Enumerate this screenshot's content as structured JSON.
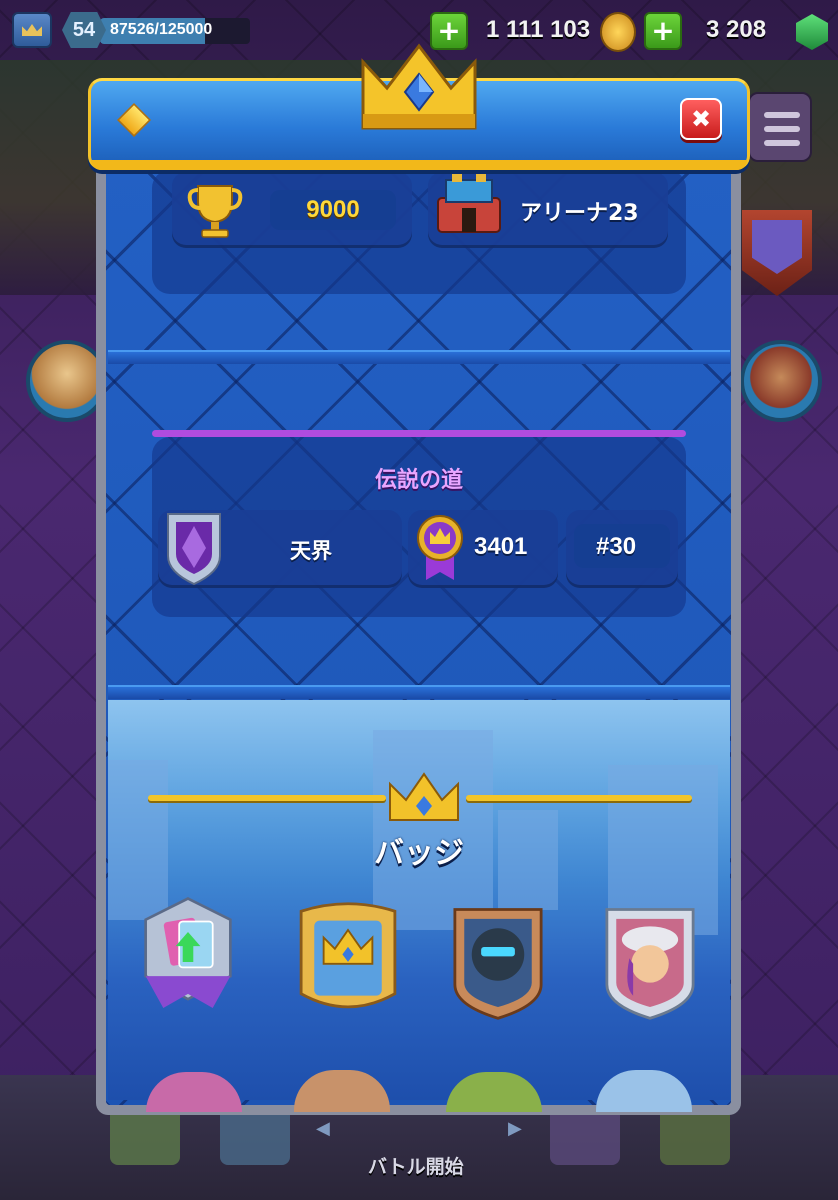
{
  "hud": {
    "level": "54",
    "xp_text": "87526/125000",
    "xp_fraction": 0.7,
    "gold": "1 111 103",
    "gems": "3 208"
  },
  "modal": {
    "close_icon": "close-icon",
    "stats": {
      "trophies": "9000",
      "arena": "アリーナ23"
    },
    "path_of_legends": {
      "title": "伝説の道",
      "league": "天界",
      "rating": "3401",
      "rank": "#30"
    },
    "badges": {
      "title": "バッジ"
    }
  },
  "bottom_nav": {
    "battle_label": "バトル開始"
  },
  "colors": {
    "modal_blue": "#1d57b8",
    "header_gold": "#f2c22a",
    "trophy_yellow": "#ffd83a",
    "legend_purple": "#b04cdf"
  }
}
